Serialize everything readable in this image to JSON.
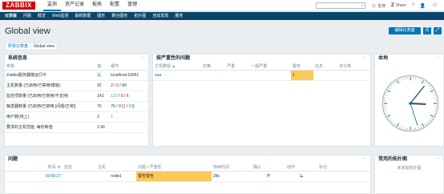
{
  "app": {
    "logo": "ZABBIX",
    "nav": [
      "监测",
      "资产记录",
      "报表",
      "配置",
      "管理"
    ],
    "active_nav": 0,
    "search_placeholder": "",
    "tools": {
      "support": "支持",
      "share": "Share",
      "help": "?"
    },
    "subnav": [
      "仪表板",
      "问题",
      "概览",
      "Web监测",
      "最新数据",
      "图形",
      "聚合图形",
      "拓扑图",
      "自动发现",
      "服务"
    ]
  },
  "page": {
    "title": "Global view",
    "edit_button": "编辑仪表盘",
    "menu_icon": "☰",
    "fullscreen_icon": "⤢",
    "breadcrumb": [
      "所有仪表盘",
      "Global view"
    ]
  },
  "sysinfo": {
    "title": "系统信息",
    "headers": [
      "参数",
      "值",
      "细节"
    ],
    "rows": [
      {
        "p": "Zabbix服务器端运行中",
        "v": "是",
        "v_color": "green",
        "d1": "localhost:10051",
        "d2": "",
        "d3": ""
      },
      {
        "p": "主机数量 (已启用/已禁用/模板)",
        "v": "92",
        "v_color": "",
        "d1": "2",
        "d2": "0",
        "d3": "90"
      },
      {
        "p": "监控项数量 (已启用/已禁用/不支持)",
        "v": "143",
        "v_color": "",
        "d1": "137",
        "d2": "0",
        "d3": "6"
      },
      {
        "p": "触发器数量 (已启用/已禁用 [问题/正常])",
        "v": "70",
        "v_color": "",
        "d1": "70",
        "d2": "0",
        "d3": "1",
        "d4": "69"
      },
      {
        "p": "用户数(线上)",
        "v": "2",
        "v_color": "",
        "d1": "1",
        "d2": "",
        "d3": ""
      },
      {
        "p": "要求的主机性能, 每秒新值",
        "v": "1.96",
        "v_color": "",
        "d1": "",
        "d2": "",
        "d3": ""
      }
    ]
  },
  "severity": {
    "title": "按严重性的问题",
    "headers": [
      "主机群组 ▲",
      "灾难",
      "严重",
      "一般严重",
      "警告",
      "信息",
      "未分类"
    ],
    "rows": [
      {
        "group": "aaa",
        "warning": "1"
      }
    ]
  },
  "clock": {
    "title": "本地",
    "hour": 3,
    "minute": 6,
    "second": 27
  },
  "problems": {
    "title": "问题",
    "headers": [
      "时间 ▼",
      "信息",
      "主机",
      "问题 • 严重性",
      "持续时间",
      "确认",
      "动作",
      "标记"
    ],
    "rows": [
      {
        "time": "16:00:27",
        "info": "",
        "host": "node1",
        "problem": "警告警告",
        "duration": "28s",
        "ack": "不",
        "actions": "1",
        "tags": ""
      }
    ]
  },
  "maps": {
    "title": "常用的拓扑图",
    "empty": "未添加拓扑图"
  },
  "colors": {
    "primary": "#0275b8",
    "header": "#0a466a",
    "logo": "#d40000",
    "warning": "#ffc859",
    "ok": "#34af67"
  }
}
